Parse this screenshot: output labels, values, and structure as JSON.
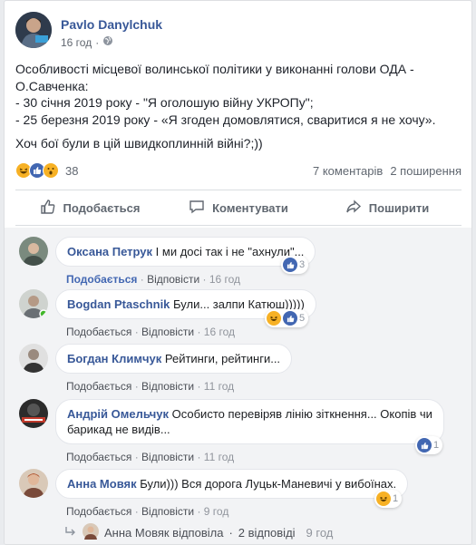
{
  "post": {
    "author": "Pavlo Danylchuk",
    "time": "16 год",
    "dot": "·",
    "text_lines": [
      "Особливості місцевої волинської політики у виконанні голови ОДА -",
      "О.Савченка:",
      "- 30 січня 2019 року - \"Я оголошую війну УКРОПу\";",
      "- 25 березня 2019 року - «Я згоден домовлятися, сваритися я не хочу»."
    ],
    "text_last": "Хоч бої були в цій швидкоплинній війні?;))",
    "reactions": [
      "haha",
      "like",
      "wow"
    ],
    "reaction_count": "38",
    "comments_count": "7 коментарів",
    "shares_count": "2 поширення"
  },
  "actions": {
    "like": "Подобається",
    "comment": "Коментувати",
    "share": "Поширити"
  },
  "comments": [
    {
      "author": "Оксана Петрук",
      "text": "І ми досі так і не \"ахнули\"...",
      "like_label": "Подобається",
      "liked": true,
      "reply": "Відповісти",
      "time": "16 год",
      "react_icons": [
        "like"
      ],
      "react_count": "3"
    },
    {
      "author": "Bogdan Ptaschnik",
      "text": "Були... залпи Катюш)))))",
      "like_label": "Подобається",
      "liked": false,
      "reply": "Відповісти",
      "time": "16 год",
      "react_icons": [
        "haha",
        "like"
      ],
      "react_count": "5"
    },
    {
      "author": "Богдан Климчук",
      "text": "Рейтинги, рейтинги...",
      "like_label": "Подобається",
      "liked": false,
      "reply": "Відповісти",
      "time": "11 год",
      "react_icons": [],
      "react_count": ""
    },
    {
      "author": "Андрій Омельчук",
      "text_line1": "Особисто перевіряв лінію зіткнення... Окопів чи",
      "text_line2": "барикад не видів...",
      "like_label": "Подобається",
      "liked": false,
      "reply": "Відповісти",
      "time": "11 год",
      "react_icons": [
        "like"
      ],
      "react_count": "1"
    },
    {
      "author": "Анна Мовяк",
      "text": "Були))) Вся дорога Луцьк-Маневичі у вибоїнах.",
      "like_label": "Подобається",
      "liked": false,
      "reply": "Відповісти",
      "time": "9 год",
      "react_icons": [
        "haha"
      ],
      "react_count": "1"
    }
  ],
  "reply_row": {
    "who": "Анна Мовяк відповіла",
    "count": "2 відповіді",
    "time": "9 год"
  },
  "colors": {
    "link": "#385898",
    "like": "#4267b2",
    "haha": "#f7b125",
    "meta": "#616770"
  },
  "icons": [
    "globe-icon",
    "like-icon",
    "comment-icon",
    "share-icon",
    "haha-emoji",
    "wow-emoji",
    "reply-arrow-icon"
  ]
}
